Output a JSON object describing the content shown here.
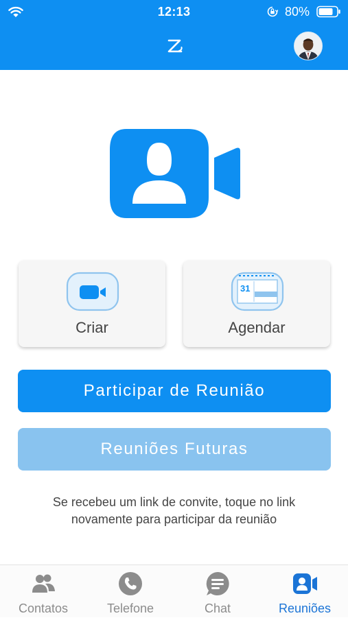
{
  "status_bar": {
    "time": "12:13",
    "battery_percent": "80%",
    "icons": [
      "wifi-icon",
      "orientation-lock-icon",
      "battery-icon"
    ]
  },
  "header": {
    "logo_icon": "zoom-logo-icon",
    "avatar": "user-avatar"
  },
  "hero": {
    "icon": "video-camera-person-icon"
  },
  "actions": {
    "create_label": "Criar",
    "create_icon": "video-camera-icon",
    "schedule_label": "Agendar",
    "schedule_icon": "calendar-icon",
    "calendar_day": "31"
  },
  "buttons": {
    "join_label": "Participar de Reunião",
    "future_label": "Reuniões Futuras"
  },
  "hint": {
    "line1": "Se recebeu um link de convite, toque no link",
    "line2": "novamente para participar da reunião"
  },
  "tabs": [
    {
      "label": "Contatos",
      "icon": "contacts-icon",
      "active": false
    },
    {
      "label": "Telefone",
      "icon": "phone-icon",
      "active": false
    },
    {
      "label": "Chat",
      "icon": "chat-icon",
      "active": false
    },
    {
      "label": "Reuniões",
      "icon": "meetings-icon",
      "active": true
    }
  ],
  "colors": {
    "primary": "#0e8ff2",
    "primary_light": "#89c3ef",
    "active_tab": "#1b74d6",
    "inactive_tab": "#8c8c8c"
  }
}
